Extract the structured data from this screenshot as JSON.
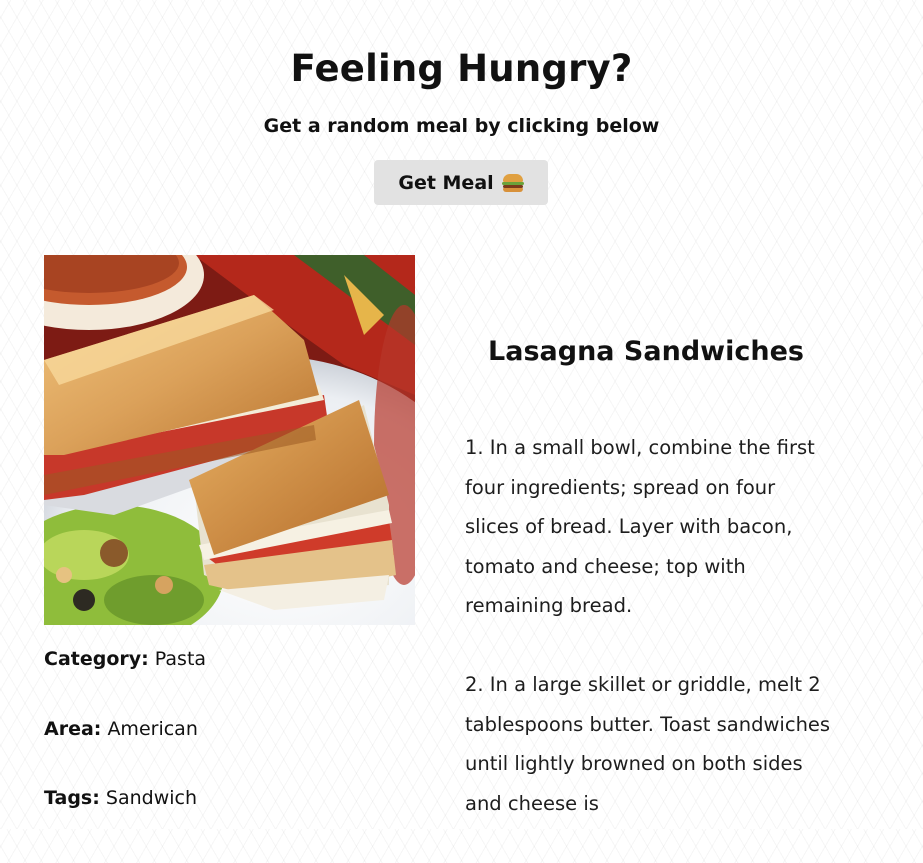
{
  "header": {
    "title": "Feeling Hungry?",
    "subtitle": "Get a random meal by clicking below",
    "button_label": "Get Meal",
    "button_icon": "hamburger-icon"
  },
  "meal": {
    "name": "Lasagna Sandwiches",
    "image_alt": "Lasagna Sandwiches",
    "category_label": "Category:",
    "category": "Pasta",
    "area_label": "Area:",
    "area": "American",
    "tags_label": "Tags:",
    "tags": "Sandwich",
    "instructions": [
      "1. In a small bowl, combine the first four ingredients; spread on four slices of bread. Layer with bacon, tomato and cheese; top with remaining bread.",
      "2. In a large skillet or griddle, melt 2 tablespoons butter. Toast sandwiches until lightly browned on both sides and cheese is"
    ]
  },
  "colors": {
    "button_bg": "#e2e2e2",
    "text": "#111111"
  }
}
